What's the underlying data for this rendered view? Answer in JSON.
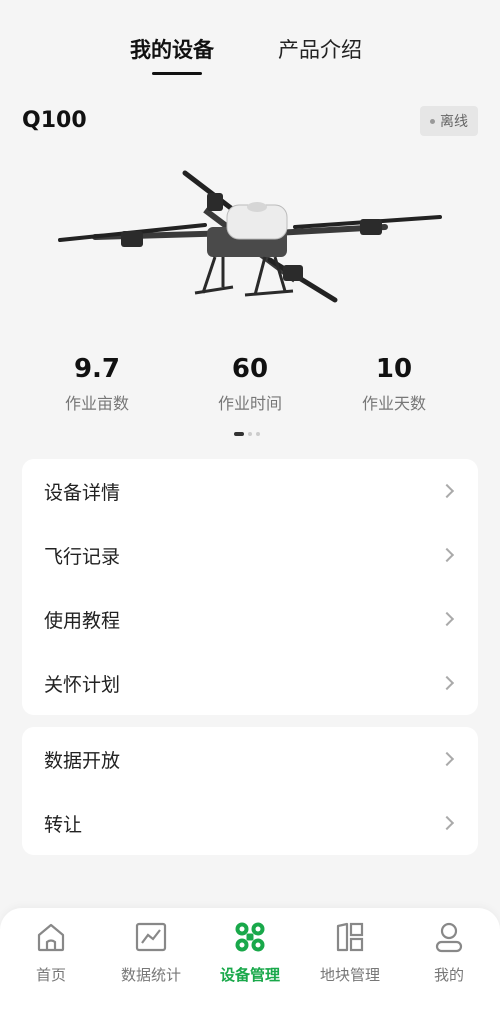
{
  "header": {
    "tabs": [
      {
        "label": "我的设备",
        "active": true
      },
      {
        "label": "产品介绍",
        "active": false
      }
    ]
  },
  "device": {
    "model": "Q100",
    "status": "离线"
  },
  "stats": [
    {
      "value": "9.7",
      "label": "作业亩数"
    },
    {
      "value": "60",
      "label": "作业时间"
    },
    {
      "value": "10",
      "label": "作业天数"
    }
  ],
  "pager": {
    "total": 3,
    "current": 1
  },
  "menu_group_1": [
    {
      "label": "设备详情"
    },
    {
      "label": "飞行记录"
    },
    {
      "label": "使用教程"
    },
    {
      "label": "关怀计划"
    }
  ],
  "menu_group_2": [
    {
      "label": "数据开放"
    },
    {
      "label": "转让"
    }
  ],
  "bottom_nav": [
    {
      "label": "首页",
      "icon": "home-icon",
      "active": false
    },
    {
      "label": "数据统计",
      "icon": "chart-icon",
      "active": false
    },
    {
      "label": "设备管理",
      "icon": "drone-icon",
      "active": true
    },
    {
      "label": "地块管理",
      "icon": "field-icon",
      "active": false
    },
    {
      "label": "我的",
      "icon": "user-icon",
      "active": false
    }
  ],
  "colors": {
    "accent": "#19a84a",
    "background": "#f5f5f5"
  }
}
